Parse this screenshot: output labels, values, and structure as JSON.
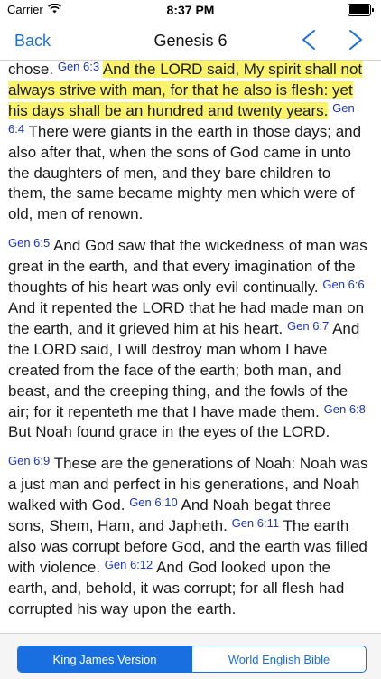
{
  "status": {
    "carrier": "Carrier",
    "time": "8:37 PM",
    "battery_level": 1.0
  },
  "nav": {
    "back_label": "Back",
    "title": "Genesis 6",
    "prev_icon": "chevron-left-icon",
    "next_icon": "chevron-right-icon"
  },
  "colors": {
    "accent": "#1a6fe0",
    "verse_ref": "#1a35c8",
    "highlight": "#fbf46a"
  },
  "passages": [
    {
      "lead_text": "chose.",
      "verses": [
        {
          "ref": "Gen 6:3",
          "text": "And the LORD said, My spirit shall not always strive with man, for that he also is flesh: yet his days shall be an hundred and twenty years.",
          "highlighted": true
        },
        {
          "ref": "Gen 6:4",
          "text": "There were giants in the earth in those days; and also after that, when the sons of God came in unto the daughters of men, and they bare children to them, the same became mighty men which were of old, men of renown.",
          "highlighted": false
        }
      ]
    },
    {
      "lead_text": "",
      "verses": [
        {
          "ref": "Gen 6:5",
          "text": "And God saw that the wickedness of man was great in the earth, and that every imagination of the thoughts of his heart was only evil continually.",
          "highlighted": false
        },
        {
          "ref": "Gen 6:6",
          "text": "And it repented the LORD that he had made man on the earth, and it grieved him at his heart.",
          "highlighted": false
        },
        {
          "ref": "Gen 6:7",
          "text": "And the LORD said, I will destroy man whom I have created from the face of the earth; both man, and beast, and the creeping thing, and the fowls of the air; for it repenteth me that I have made them.",
          "highlighted": false
        },
        {
          "ref": "Gen 6:8",
          "text": "But Noah found grace in the eyes of the LORD.",
          "highlighted": false
        }
      ]
    },
    {
      "lead_text": "",
      "verses": [
        {
          "ref": "Gen 6:9",
          "text": "These are the generations of Noah: Noah was a just man and perfect in his generations, and Noah walked with God.",
          "highlighted": false
        },
        {
          "ref": "Gen 6:10",
          "text": "And Noah begat three sons, Shem, Ham, and Japheth.",
          "highlighted": false
        },
        {
          "ref": "Gen 6:11",
          "text": "The earth also was corrupt before God, and the earth was filled with violence.",
          "highlighted": false
        },
        {
          "ref": "Gen 6:12",
          "text": "And God looked upon the earth, and, behold, it was corrupt; for all flesh had corrupted his way upon the earth.",
          "highlighted": false
        }
      ]
    }
  ],
  "versions": {
    "selected": "King James Version",
    "options": [
      "King James Version",
      "World English Bible"
    ]
  }
}
